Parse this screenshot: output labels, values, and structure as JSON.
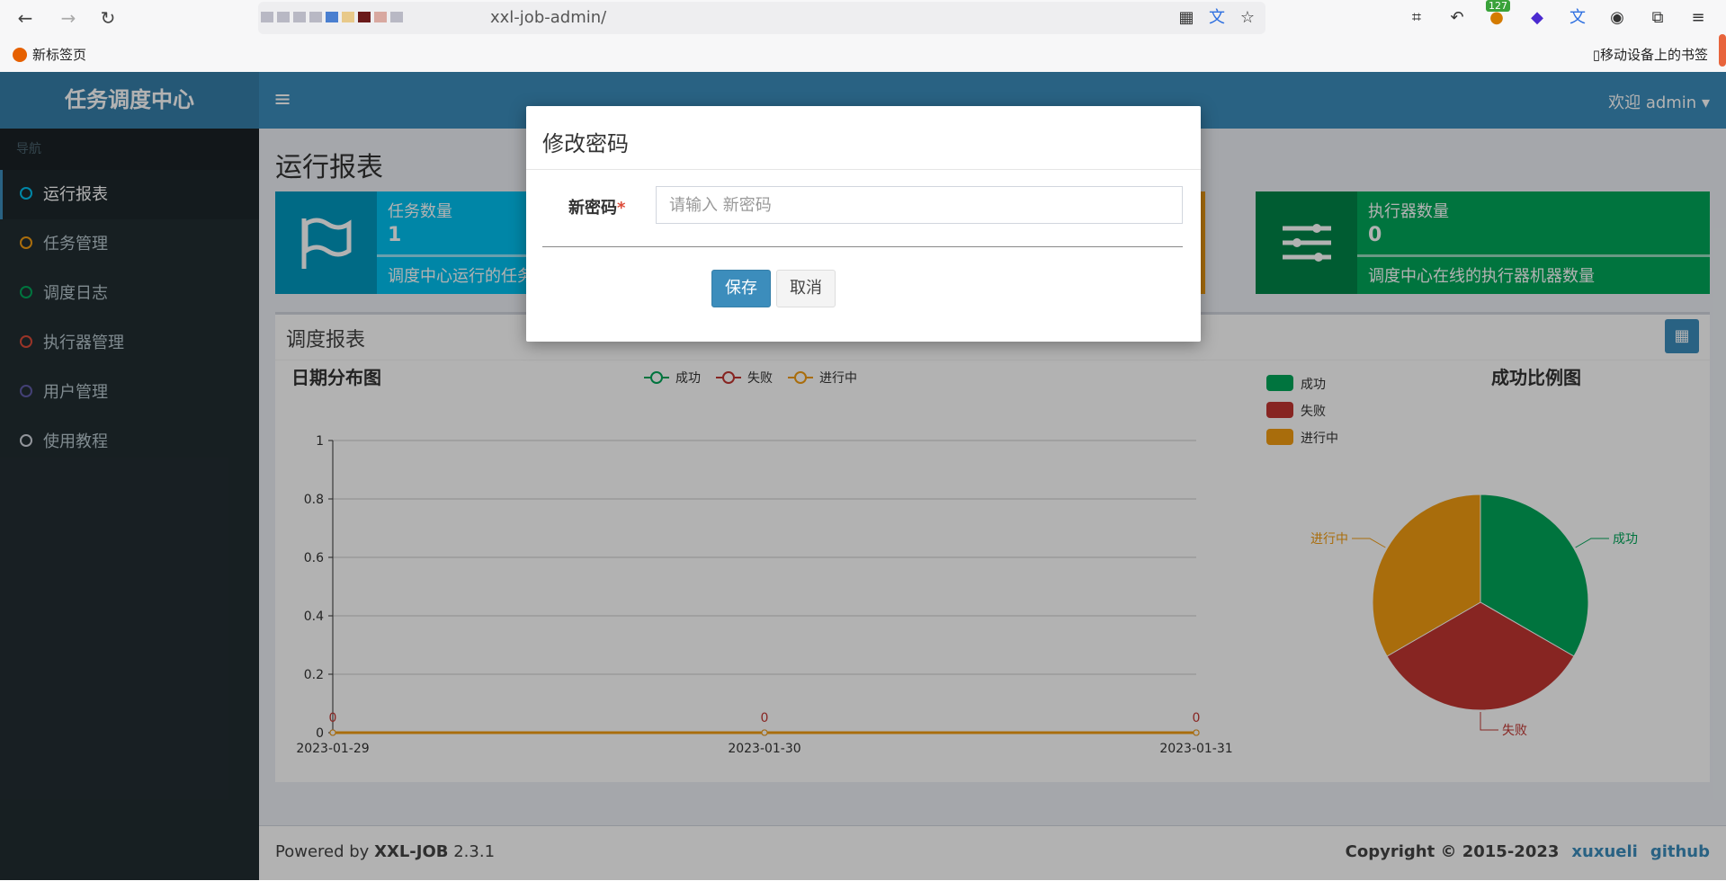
{
  "browser": {
    "url_path": "xxl-job-admin/",
    "extension_badge": "127",
    "bookmark_left": "新标签页",
    "bookmark_right": "移动设备上的书签"
  },
  "app": {
    "logo": "任务调度中心",
    "nav_header": "导航",
    "nav_items": [
      {
        "label": "运行报表",
        "color": "#00c0ef"
      },
      {
        "label": "任务管理",
        "color": "#f39c12"
      },
      {
        "label": "调度日志",
        "color": "#00a65a"
      },
      {
        "label": "执行器管理",
        "color": "#dd4b39"
      },
      {
        "label": "用户管理",
        "color": "#605ca8"
      },
      {
        "label": "使用教程",
        "color": "#d2d6de"
      }
    ],
    "welcome": "欢迎 admin",
    "page_title": "运行报表"
  },
  "cards": [
    {
      "title": "任务数量",
      "value": "1",
      "desc": "调度中心运行的任务",
      "color": "#00c0ef"
    },
    {
      "title": "执行器数量",
      "value": "0",
      "desc": "调度中心在线的执行器机器数量",
      "color": "#00a65a"
    }
  ],
  "report": {
    "title": "调度报表",
    "line_title": "日期分布图",
    "pie_title": "成功比例图"
  },
  "chart_data": [
    {
      "type": "line",
      "title": "日期分布图",
      "x": [
        "2023-01-29",
        "2023-01-30",
        "2023-01-31"
      ],
      "series": [
        {
          "name": "成功",
          "values": [
            0,
            0,
            0
          ],
          "color": "#00a65a"
        },
        {
          "name": "失败",
          "values": [
            0,
            0,
            0
          ],
          "color": "#c23632"
        },
        {
          "name": "进行中",
          "values": [
            0,
            0,
            0
          ],
          "color": "#f39c12"
        }
      ],
      "ylim": [
        0,
        1
      ],
      "yticks": [
        "0",
        "0.2",
        "0.4",
        "0.6",
        "0.8",
        "1"
      ],
      "data_labels": [
        "0",
        "0",
        "0"
      ],
      "legend": "top",
      "grid": true
    },
    {
      "type": "pie",
      "title": "成功比例图",
      "slices": [
        {
          "name": "成功",
          "value": 1,
          "color": "#00a65a"
        },
        {
          "name": "失败",
          "value": 1,
          "color": "#c23632"
        },
        {
          "name": "进行中",
          "value": 1,
          "color": "#f39c12"
        }
      ],
      "legend": "top-left"
    }
  ],
  "footer": {
    "powered": "Powered by",
    "brand": "XXL-JOB",
    "version": "2.3.1",
    "copyright": "Copyright © 2015-2023",
    "link1": "xuxueli",
    "link2": "github"
  },
  "modal": {
    "title": "修改密码",
    "label": "新密码",
    "required_mark": "*",
    "placeholder": "请输入 新密码",
    "save": "保存",
    "cancel": "取消"
  }
}
